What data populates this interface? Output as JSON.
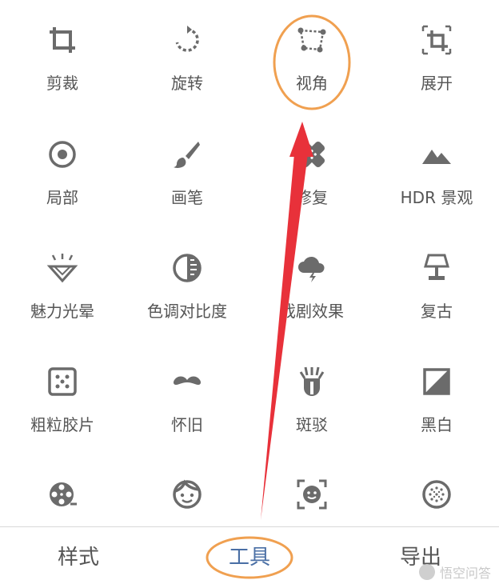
{
  "tools": [
    {
      "label": "剪裁",
      "icon": "crop-icon"
    },
    {
      "label": "旋转",
      "icon": "rotate-icon"
    },
    {
      "label": "视角",
      "icon": "perspective-icon"
    },
    {
      "label": "展开",
      "icon": "expand-icon"
    },
    {
      "label": "局部",
      "icon": "selective-icon"
    },
    {
      "label": "画笔",
      "icon": "brush-icon"
    },
    {
      "label": "修复",
      "icon": "healing-icon"
    },
    {
      "label": "HDR 景观",
      "icon": "hdr-icon"
    },
    {
      "label": "魅力光晕",
      "icon": "glamour-glow-icon"
    },
    {
      "label": "色调对比度",
      "icon": "tonal-contrast-icon"
    },
    {
      "label": "戏剧效果",
      "icon": "drama-icon"
    },
    {
      "label": "复古",
      "icon": "vintage-icon"
    },
    {
      "label": "粗粒胶片",
      "icon": "grainy-film-icon"
    },
    {
      "label": "怀旧",
      "icon": "retrolux-icon"
    },
    {
      "label": "斑驳",
      "icon": "grunge-icon"
    },
    {
      "label": "黑白",
      "icon": "black-white-icon"
    },
    {
      "label": "",
      "icon": "film-reel-icon"
    },
    {
      "label": "",
      "icon": "face-icon"
    },
    {
      "label": "",
      "icon": "face-pose-icon"
    },
    {
      "label": "",
      "icon": "double-exposure-icon"
    }
  ],
  "bottom_tabs": {
    "styles": "样式",
    "tools": "工具",
    "export": "导出"
  },
  "watermark": "悟空问答",
  "colors": {
    "icon": "#6b6b6b",
    "label": "#555555",
    "active_tab": "#4a6fa5",
    "annotation_circle": "#f0a050",
    "annotation_arrow": "#e8313a"
  }
}
